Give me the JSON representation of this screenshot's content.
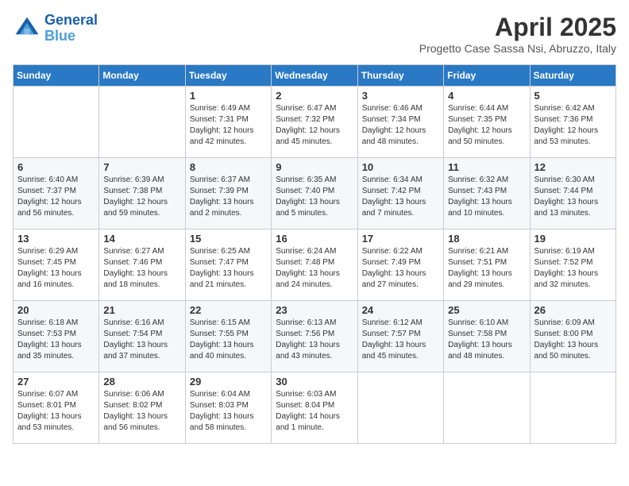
{
  "logo": {
    "line1": "General",
    "line2": "Blue"
  },
  "title": "April 2025",
  "subtitle": "Progetto Case Sassa Nsi, Abruzzo, Italy",
  "days_of_week": [
    "Sunday",
    "Monday",
    "Tuesday",
    "Wednesday",
    "Thursday",
    "Friday",
    "Saturday"
  ],
  "weeks": [
    [
      {
        "day": "",
        "info": ""
      },
      {
        "day": "",
        "info": ""
      },
      {
        "day": "1",
        "info": "Sunrise: 6:49 AM\nSunset: 7:31 PM\nDaylight: 12 hours and 42 minutes."
      },
      {
        "day": "2",
        "info": "Sunrise: 6:47 AM\nSunset: 7:32 PM\nDaylight: 12 hours and 45 minutes."
      },
      {
        "day": "3",
        "info": "Sunrise: 6:46 AM\nSunset: 7:34 PM\nDaylight: 12 hours and 48 minutes."
      },
      {
        "day": "4",
        "info": "Sunrise: 6:44 AM\nSunset: 7:35 PM\nDaylight: 12 hours and 50 minutes."
      },
      {
        "day": "5",
        "info": "Sunrise: 6:42 AM\nSunset: 7:36 PM\nDaylight: 12 hours and 53 minutes."
      }
    ],
    [
      {
        "day": "6",
        "info": "Sunrise: 6:40 AM\nSunset: 7:37 PM\nDaylight: 12 hours and 56 minutes."
      },
      {
        "day": "7",
        "info": "Sunrise: 6:39 AM\nSunset: 7:38 PM\nDaylight: 12 hours and 59 minutes."
      },
      {
        "day": "8",
        "info": "Sunrise: 6:37 AM\nSunset: 7:39 PM\nDaylight: 13 hours and 2 minutes."
      },
      {
        "day": "9",
        "info": "Sunrise: 6:35 AM\nSunset: 7:40 PM\nDaylight: 13 hours and 5 minutes."
      },
      {
        "day": "10",
        "info": "Sunrise: 6:34 AM\nSunset: 7:42 PM\nDaylight: 13 hours and 7 minutes."
      },
      {
        "day": "11",
        "info": "Sunrise: 6:32 AM\nSunset: 7:43 PM\nDaylight: 13 hours and 10 minutes."
      },
      {
        "day": "12",
        "info": "Sunrise: 6:30 AM\nSunset: 7:44 PM\nDaylight: 13 hours and 13 minutes."
      }
    ],
    [
      {
        "day": "13",
        "info": "Sunrise: 6:29 AM\nSunset: 7:45 PM\nDaylight: 13 hours and 16 minutes."
      },
      {
        "day": "14",
        "info": "Sunrise: 6:27 AM\nSunset: 7:46 PM\nDaylight: 13 hours and 18 minutes."
      },
      {
        "day": "15",
        "info": "Sunrise: 6:25 AM\nSunset: 7:47 PM\nDaylight: 13 hours and 21 minutes."
      },
      {
        "day": "16",
        "info": "Sunrise: 6:24 AM\nSunset: 7:48 PM\nDaylight: 13 hours and 24 minutes."
      },
      {
        "day": "17",
        "info": "Sunrise: 6:22 AM\nSunset: 7:49 PM\nDaylight: 13 hours and 27 minutes."
      },
      {
        "day": "18",
        "info": "Sunrise: 6:21 AM\nSunset: 7:51 PM\nDaylight: 13 hours and 29 minutes."
      },
      {
        "day": "19",
        "info": "Sunrise: 6:19 AM\nSunset: 7:52 PM\nDaylight: 13 hours and 32 minutes."
      }
    ],
    [
      {
        "day": "20",
        "info": "Sunrise: 6:18 AM\nSunset: 7:53 PM\nDaylight: 13 hours and 35 minutes."
      },
      {
        "day": "21",
        "info": "Sunrise: 6:16 AM\nSunset: 7:54 PM\nDaylight: 13 hours and 37 minutes."
      },
      {
        "day": "22",
        "info": "Sunrise: 6:15 AM\nSunset: 7:55 PM\nDaylight: 13 hours and 40 minutes."
      },
      {
        "day": "23",
        "info": "Sunrise: 6:13 AM\nSunset: 7:56 PM\nDaylight: 13 hours and 43 minutes."
      },
      {
        "day": "24",
        "info": "Sunrise: 6:12 AM\nSunset: 7:57 PM\nDaylight: 13 hours and 45 minutes."
      },
      {
        "day": "25",
        "info": "Sunrise: 6:10 AM\nSunset: 7:58 PM\nDaylight: 13 hours and 48 minutes."
      },
      {
        "day": "26",
        "info": "Sunrise: 6:09 AM\nSunset: 8:00 PM\nDaylight: 13 hours and 50 minutes."
      }
    ],
    [
      {
        "day": "27",
        "info": "Sunrise: 6:07 AM\nSunset: 8:01 PM\nDaylight: 13 hours and 53 minutes."
      },
      {
        "day": "28",
        "info": "Sunrise: 6:06 AM\nSunset: 8:02 PM\nDaylight: 13 hours and 56 minutes."
      },
      {
        "day": "29",
        "info": "Sunrise: 6:04 AM\nSunset: 8:03 PM\nDaylight: 13 hours and 58 minutes."
      },
      {
        "day": "30",
        "info": "Sunrise: 6:03 AM\nSunset: 8:04 PM\nDaylight: 14 hours and 1 minute."
      },
      {
        "day": "",
        "info": ""
      },
      {
        "day": "",
        "info": ""
      },
      {
        "day": "",
        "info": ""
      }
    ]
  ]
}
